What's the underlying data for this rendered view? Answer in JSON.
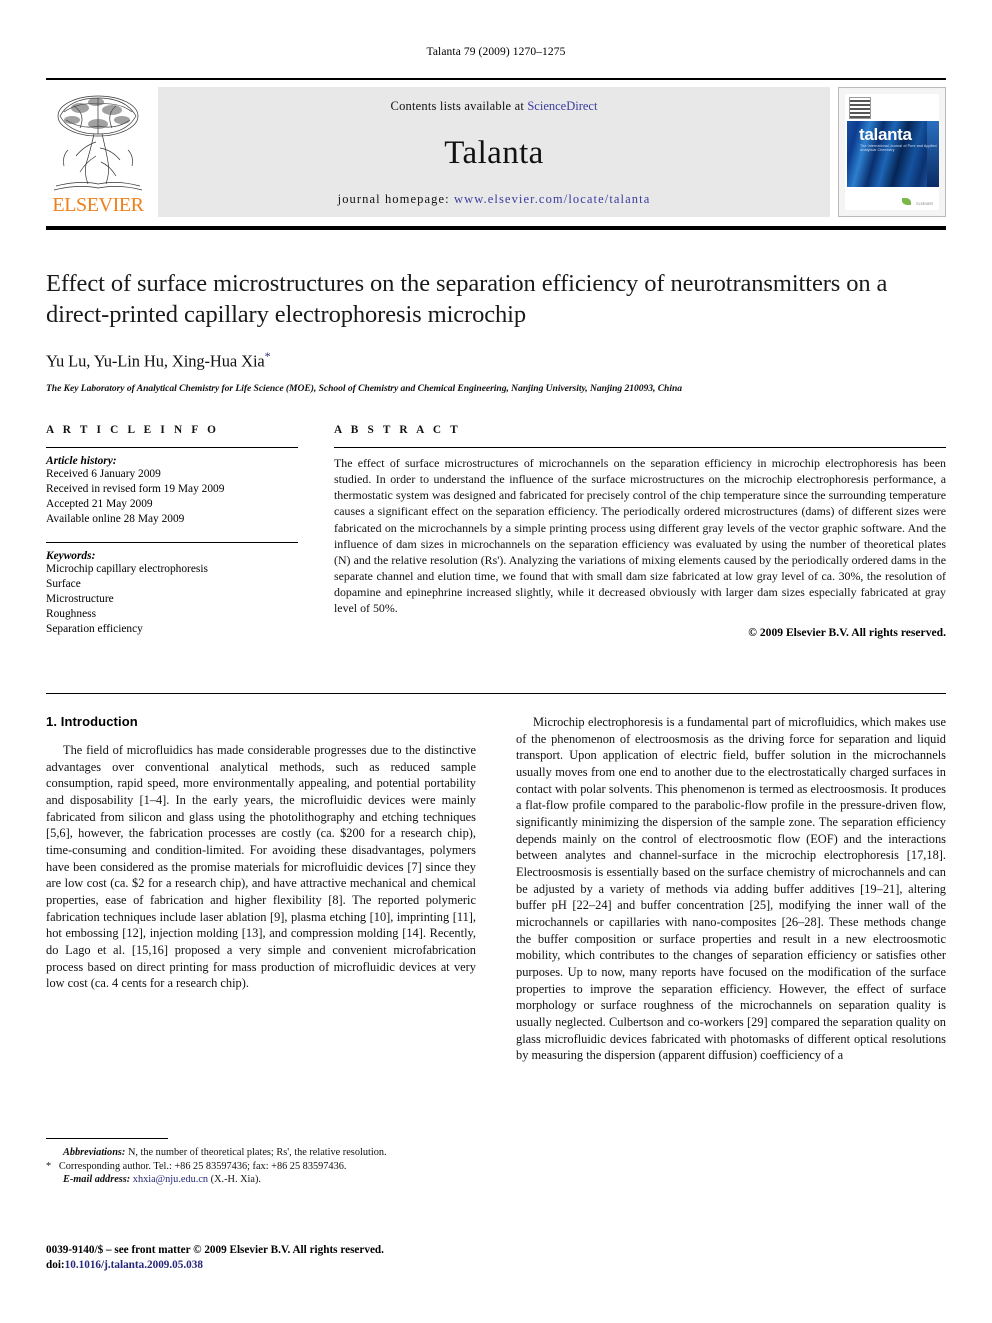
{
  "running_head": "Talanta 79 (2009) 1270–1275",
  "masthead": {
    "contents_prefix": "Contents lists available at ",
    "sciencedirect": "ScienceDirect",
    "journal_title": "Talanta",
    "homepage_prefix": "journal homepage:",
    "homepage_url": "www.elsevier.com/locate/talanta",
    "publisher": "ELSEVIER",
    "cover_title": "talanta",
    "cover_subtitle": "The International Journal of Pure and Applied Analytical Chemistry",
    "cover_footer": "ELSEVIER",
    "accent_orange": "#F07F1A",
    "link_blue": "#3b3b9e"
  },
  "article": {
    "title": "Effect of surface microstructures on the separation efficiency of neurotransmitters on a direct-printed capillary electrophoresis microchip",
    "authors": "Yu Lu, Yu-Lin Hu, Xing-Hua Xia",
    "corresponding_marker": "*",
    "affiliation": "The Key Laboratory of Analytical Chemistry for Life Science (MOE), School of Chemistry and Chemical Engineering, Nanjing University, Nanjing 210093, China"
  },
  "article_info": {
    "heading": "A R T I C L E   I N F O",
    "history_label": "Article history:",
    "history": [
      "Received 6 January 2009",
      "Received in revised form 19 May 2009",
      "Accepted 21 May 2009",
      "Available online 28 May 2009"
    ],
    "keywords_label": "Keywords:",
    "keywords": [
      "Microchip capillary electrophoresis",
      "Surface",
      "Microstructure",
      "Roughness",
      "Separation efficiency"
    ]
  },
  "abstract": {
    "heading": "A B S T R A C T",
    "text": "The effect of surface microstructures of microchannels on the separation efficiency in microchip electrophoresis has been studied. In order to understand the influence of the surface microstructures on the microchip electrophoresis performance, a thermostatic system was designed and fabricated for precisely control of the chip temperature since the surrounding temperature causes a significant effect on the separation efficiency. The periodically ordered microstructures (dams) of different sizes were fabricated on the microchannels by a simple printing process using different gray levels of the vector graphic software. And the influence of dam sizes in microchannels on the separation efficiency was evaluated by using the number of theoretical plates (N) and the relative resolution (Rs'). Analyzing the variations of mixing elements caused by the periodically ordered dams in the separate channel and elution time, we found that with small dam size fabricated at low gray level of ca. 30%, the resolution of dopamine and epinephrine increased slightly, while it decreased obviously with larger dam sizes especially fabricated at gray level of 50%.",
    "copyright": "© 2009 Elsevier B.V. All rights reserved."
  },
  "body": {
    "section_title": "1.  Introduction",
    "left_paragraph_1": "The field of microfluidics has made considerable progresses due to the distinctive advantages over conventional analytical methods, such as reduced sample consumption, rapid speed, more environmentally appealing, and potential portability and disposability [1–4]. In the early years, the microfluidic devices were mainly fabricated from silicon and glass using the photolithography and etching techniques [5,6], however, the fabrication processes are costly (ca. $200 for a research chip), time-consuming and condition-limited. For avoiding these disadvantages, polymers have been considered as the promise materials for microfluidic devices [7] since they are low cost (ca. $2 for a research chip), and have attractive mechanical and chemical properties, ease of fabrication and higher flexibility [8]. The reported polymeric fabrication techniques include laser ablation [9], plasma etching [10], imprinting [11], hot embossing [12], injection molding [13], and compression molding [14]. Recently, do Lago et al. [15,16] proposed a very simple and convenient microfabrication process based on direct printing for mass production of microfluidic devices at very low cost (ca. 4 cents for a research chip).",
    "right_paragraph_1": "Microchip electrophoresis is a fundamental part of microfluidics, which makes use of the phenomenon of electroosmosis as the driving force for separation and liquid transport. Upon application of electric field, buffer solution in the microchannels usually moves from one end to another due to the electrostatically charged surfaces in contact with polar solvents. This phenomenon is termed as electroosmosis. It produces a flat-flow profile compared to the parabolic-flow profile in the pressure-driven flow, significantly minimizing the dispersion of the sample zone. The separation efficiency depends mainly on the control of electroosmotic flow (EOF) and the interactions between analytes and channel-surface in the microchip electrophoresis [17,18]. Electroosmosis is essentially based on the surface chemistry of microchannels and can be adjusted by a variety of methods via adding buffer additives [19–21], altering buffer pH [22–24] and buffer concentration [25], modifying the inner wall of the microchannels or capillaries with nano-composites [26–28]. These methods change the buffer composition or surface properties and result in a new electroosmotic mobility, which contributes to the changes of separation efficiency or satisfies other purposes. Up to now, many reports have focused on the modification of the surface properties to improve the separation efficiency. However, the effect of surface morphology or surface roughness of the microchannels on separation quality is usually neglected. Culbertson and co-workers [29] compared the separation quality on glass microfluidic devices fabricated with photomasks of different optical resolutions by measuring the dispersion (apparent diffusion) coefficiency of a"
  },
  "footnotes": {
    "abbreviations_label": "Abbreviations:",
    "abbreviations_text": "N, the number of theoretical plates; Rs', the relative resolution.",
    "corresponding_marker": "*",
    "corresponding_text": "Corresponding author. Tel.: +86 25 83597436; fax: +86 25 83597436.",
    "email_label": "E-mail address:",
    "email_value": "xhxia@nju.edu.cn",
    "email_suffix": "(X.-H. Xia)."
  },
  "imprint": {
    "issn_line": "0039-9140/$ – see front matter © 2009 Elsevier B.V. All rights reserved.",
    "doi_prefix": "doi:",
    "doi_value": "10.1016/j.talanta.2009.05.038"
  }
}
